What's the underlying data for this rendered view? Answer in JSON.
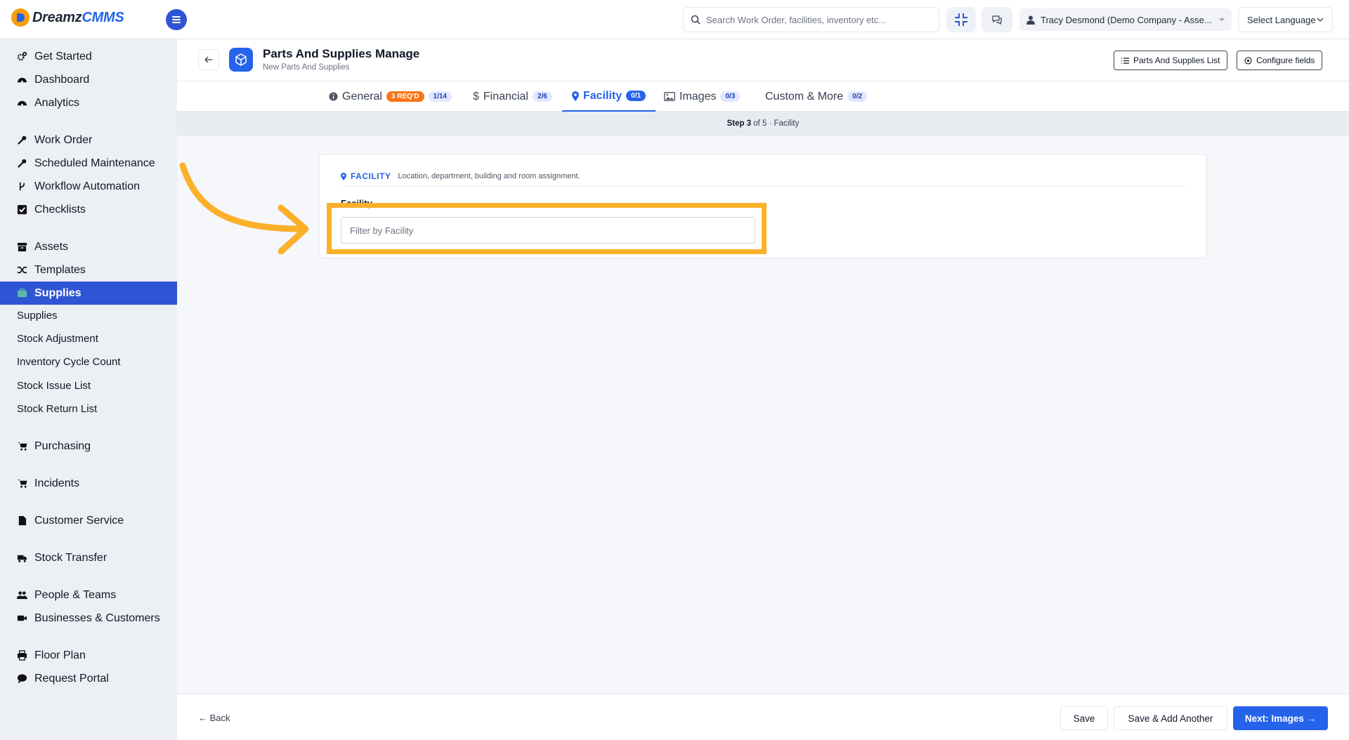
{
  "brand": {
    "name_part1": "Dreamz",
    "name_part2": "CMMS",
    "accent": "#2563eb",
    "logo_color": "#f59e0b"
  },
  "topbar": {
    "search_placeholder": "Search Work Order, facilities, inventory etc...",
    "user_name": "Tracy Desmond (Demo Company - Asse...",
    "language_label": "Select Language",
    "icons": [
      "menu-icon",
      "search-icon",
      "expand-icon",
      "chat-icon",
      "user-icon",
      "chevron-down-icon"
    ]
  },
  "sidebar": {
    "items": [
      {
        "label": "Get Started",
        "icon": "gears-icon"
      },
      {
        "label": "Dashboard",
        "icon": "gauge-icon"
      },
      {
        "label": "Analytics",
        "icon": "gauge-icon"
      },
      {
        "label": "Work Order",
        "icon": "wrench-icon"
      },
      {
        "label": "Scheduled Maintenance",
        "icon": "wrench-icon"
      },
      {
        "label": "Workflow Automation",
        "icon": "branch-icon"
      },
      {
        "label": "Checklists",
        "icon": "check-square-icon"
      },
      {
        "label": "Assets",
        "icon": "archive-icon"
      },
      {
        "label": "Templates",
        "icon": "shuffle-icon"
      },
      {
        "label": "Supplies",
        "icon": "suitcase-icon"
      },
      {
        "label": "Purchasing",
        "icon": "cart-icon"
      },
      {
        "label": "Incidents",
        "icon": "cart-icon"
      },
      {
        "label": "Customer Service",
        "icon": "file-icon"
      },
      {
        "label": "Stock Transfer",
        "icon": "truck-icon"
      },
      {
        "label": "People & Teams",
        "icon": "users-icon"
      },
      {
        "label": "Businesses & Customers",
        "icon": "video-icon"
      },
      {
        "label": "Floor Plan",
        "icon": "print-icon"
      },
      {
        "label": "Request Portal",
        "icon": "comment-icon"
      }
    ],
    "supplies_sub": [
      "Supplies",
      "Stock Adjustment",
      "Inventory Cycle Count",
      "Stock Issue List",
      "Stock Return List"
    ],
    "active_item": "Supplies"
  },
  "header": {
    "title": "Parts And Supplies Manage",
    "subtitle": "New Parts And Supplies",
    "list_button": "Parts And Supplies List",
    "configure_button": "Configure fields"
  },
  "tabs": [
    {
      "label": "General",
      "badge_req": "3 REQ'D",
      "count": "1/14",
      "icon": "info-icon"
    },
    {
      "label": "Financial",
      "count": "2/6",
      "icon": "dollar-icon"
    },
    {
      "label": "Facility",
      "count": "0/1",
      "icon": "map-pin-icon",
      "active": true
    },
    {
      "label": "Images",
      "count": "0/3",
      "icon": "image-icon"
    },
    {
      "label": "Custom & More",
      "count": "0/2"
    }
  ],
  "step": {
    "current": "Step 3",
    "rest": "of 5 · Facility"
  },
  "section": {
    "label": "FACILITY",
    "description": "Location, department, building and room assignment.",
    "field_label": "Facility",
    "field_placeholder": "Filter by Facility",
    "field_value": ""
  },
  "annotation": {
    "highlight_color": "#fbb02a"
  },
  "footer": {
    "back": "← Back",
    "save": "Save",
    "save_add": "Save & Add Another",
    "next": "Next: Images →"
  }
}
